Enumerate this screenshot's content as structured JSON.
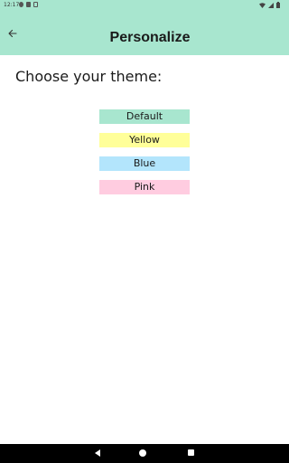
{
  "status_bar": {
    "time": "12:17",
    "icons_left": [
      "notification-a-icon",
      "sd-card-icon",
      "sim-icon"
    ],
    "icons_right": [
      "wifi-icon",
      "signal-icon",
      "battery-icon"
    ]
  },
  "app_bar": {
    "title": "Personalize",
    "back_icon": "arrow-back-icon",
    "background": "#a8e6cf"
  },
  "main": {
    "prompt": "Choose your theme:",
    "themes": [
      {
        "label": "Default",
        "color": "#a8e6cf"
      },
      {
        "label": "Yellow",
        "color": "#ffff99"
      },
      {
        "label": "Blue",
        "color": "#b3e5fc"
      },
      {
        "label": "Pink",
        "color": "#ffcce0"
      }
    ]
  },
  "nav_bar": {
    "icons": [
      "nav-back-icon",
      "nav-home-icon",
      "nav-recents-icon"
    ]
  }
}
